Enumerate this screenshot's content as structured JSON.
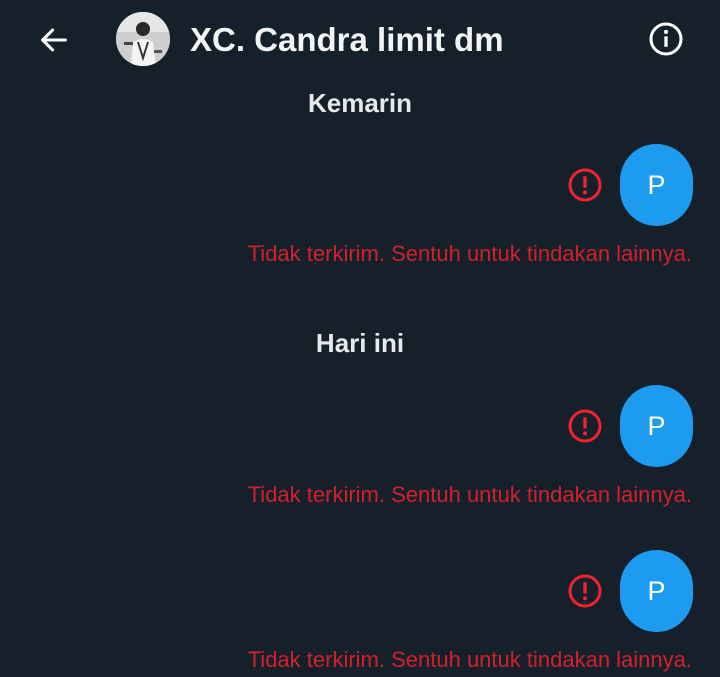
{
  "header": {
    "title": "XC. Candra limit dm",
    "back_icon": "arrow-left-icon",
    "info_icon": "info-circle-icon"
  },
  "conversation": {
    "groups": [
      {
        "date_label": "Kemarin",
        "messages": [
          {
            "text": "P",
            "status": "Tidak terkirim. Sentuh untuk tindakan lainnya.",
            "status_icon": "alert-circle-icon"
          }
        ]
      },
      {
        "date_label": "Hari ini",
        "messages": [
          {
            "text": "P",
            "status": "Tidak terkirim. Sentuh untuk tindakan lainnya.",
            "status_icon": "alert-circle-icon"
          },
          {
            "text": "P",
            "status": "Tidak terkirim. Sentuh untuk tindakan lainnya.",
            "status_icon": "alert-circle-icon"
          }
        ]
      }
    ]
  },
  "colors": {
    "background": "#15202b",
    "bubble": "#1d9bf0",
    "error": "#f4212e",
    "text": "#e7e9ea"
  }
}
